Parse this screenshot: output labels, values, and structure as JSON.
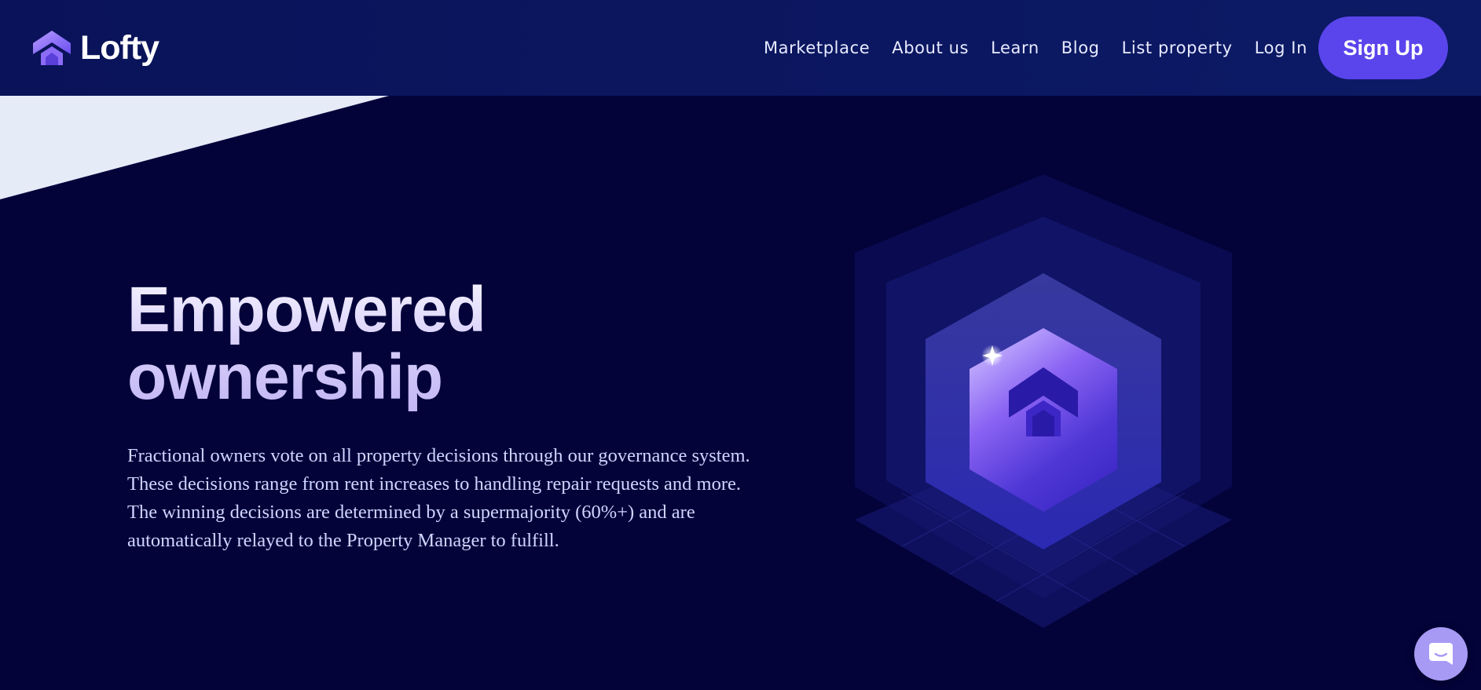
{
  "brand": {
    "name": "Lofty",
    "logo_icon": "house-chevron-icon"
  },
  "nav": {
    "items": [
      {
        "label": "Marketplace"
      },
      {
        "label": "About us"
      },
      {
        "label": "Learn"
      },
      {
        "label": "Blog"
      },
      {
        "label": "List property"
      },
      {
        "label": "Log In"
      }
    ],
    "signup_label": "Sign Up"
  },
  "hero": {
    "title_line1": "Empowered",
    "title_line2": "ownership",
    "description": "Fractional owners vote on all property decisions through our governance system. These decisions range from rent increases to handling repair requests and more. The winning decisions are determined by a supermajority (60%+) and are automatically relayed to the Property Manager to fulfill.",
    "illustration_icon": "hexagon-house-icon"
  },
  "chat": {
    "icon": "chat-bubble-icon"
  },
  "colors": {
    "header_bg": "#0b1760",
    "page_bg": "#03033a",
    "accent": "#5a45ec",
    "chat_bg": "#a79af5",
    "wedge": "#e6ebf8"
  }
}
